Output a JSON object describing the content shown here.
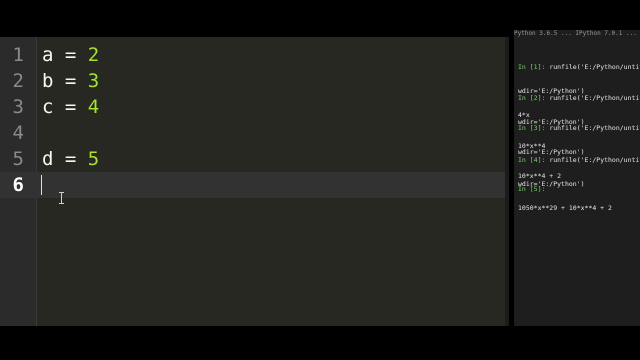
{
  "console": {
    "header_fragment": "Python 3.6.5 ... IPython 7.0.1 ...",
    "entries": [
      {
        "prompt": "In [1]:",
        "call": " runfile('E:/Python/untitle",
        "wdir": "wdir='E:/Python')",
        "output": "4*x"
      },
      {
        "prompt": "In [2]:",
        "call": " runfile('E:/Python/untitle",
        "wdir": "wdir='E:/Python')",
        "output": "10*x**4"
      },
      {
        "prompt": "In [3]:",
        "call": " runfile('E:/Python/untitle",
        "wdir": "wdir='E:/Python')",
        "output": "10*x**4 + 2"
      },
      {
        "prompt": "In [4]:",
        "call": " runfile('E:/Python/untitle",
        "wdir": "wdir='E:/Python')",
        "output": "1050*x**29 + 10*x**4 + 2"
      },
      {
        "prompt": "In [5]:",
        "call": "",
        "wdir": "",
        "output": ""
      }
    ]
  },
  "editor": {
    "lines": [
      {
        "num": "1",
        "var": "a",
        "op": " = ",
        "val": "2"
      },
      {
        "num": "2",
        "var": "b",
        "op": " = ",
        "val": "3"
      },
      {
        "num": "3",
        "var": "c",
        "op": " = ",
        "val": "4"
      },
      {
        "num": "4",
        "var": "",
        "op": "",
        "val": ""
      },
      {
        "num": "5",
        "var": "d",
        "op": " = ",
        "val": "5"
      },
      {
        "num": "6",
        "var": "",
        "op": "",
        "val": ""
      }
    ],
    "current_line": "6"
  },
  "colors": {
    "editor_bg": "#272822",
    "number": "#a6e22e",
    "prompt": "#7bd66b"
  }
}
